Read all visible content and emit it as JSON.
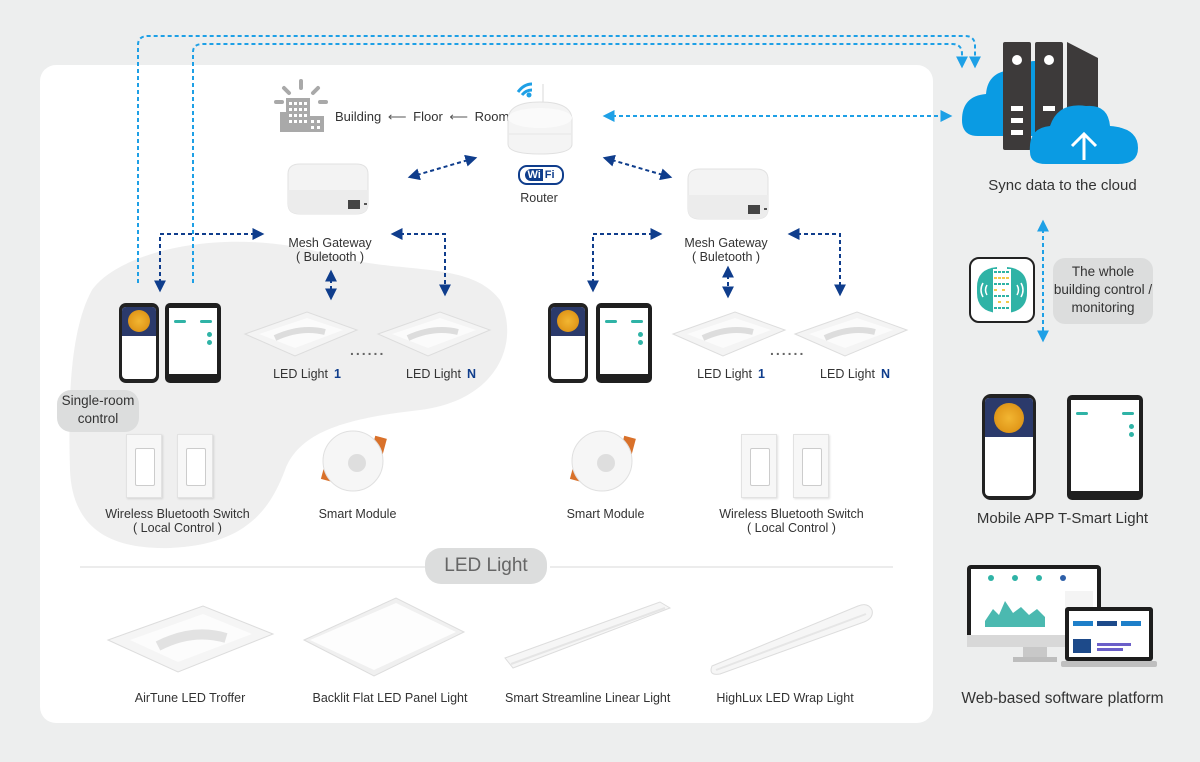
{
  "hierarchy": {
    "building": "Building",
    "floor": "Floor",
    "room": "Room",
    "arrow": "⟵"
  },
  "router": {
    "wifi_badge_left": "Wi",
    "wifi_badge_right": "Fi",
    "label": "Router"
  },
  "left_zone": {
    "gateway_line1": "Mesh Gateway",
    "gateway_line2": "( Buletooth )",
    "led1_label": "LED Light",
    "led1_num": "1",
    "ledN_label": "LED Light",
    "ledN_num": "N",
    "ellipsis": "......",
    "single_room_line1": "Single-room",
    "single_room_line2": "control",
    "switch_line1": "Wireless Bluetooth Switch",
    "switch_line2": "( Local Control )",
    "module_label": "Smart Module"
  },
  "right_zone": {
    "gateway_line1": "Mesh Gateway",
    "gateway_line2": "( Buletooth )",
    "led1_label": "LED Light",
    "led1_num": "1",
    "ledN_label": "LED Light",
    "ledN_num": "N",
    "ellipsis": "......",
    "module_label": "Smart Module",
    "switch_line1": "Wireless Bluetooth Switch",
    "switch_line2": "( Local Control )"
  },
  "led_section": {
    "title": "LED Light",
    "products": [
      {
        "name": "AirTune  LED Troffer"
      },
      {
        "name": "Backlit Flat LED Panel Light"
      },
      {
        "name": "Smart Streamline Linear Light"
      },
      {
        "name": "HighLux LED Wrap Light"
      }
    ]
  },
  "sidebar": {
    "cloud_label": "Sync data to the cloud",
    "building_pill_line1": "The whole",
    "building_pill_line2": "building control /",
    "building_pill_line3": "monitoring",
    "mobile_label": "Mobile APP T-Smart Light",
    "web_label": "Web-based software platform"
  },
  "colors": {
    "cloud_blue": "#0a9be3",
    "link_light_blue": "#1ea0e6",
    "link_dark_blue": "#0f3d8c",
    "server_dark": "#3d3a3a",
    "teal": "#2fb3a6",
    "orange": "#d9712a"
  }
}
